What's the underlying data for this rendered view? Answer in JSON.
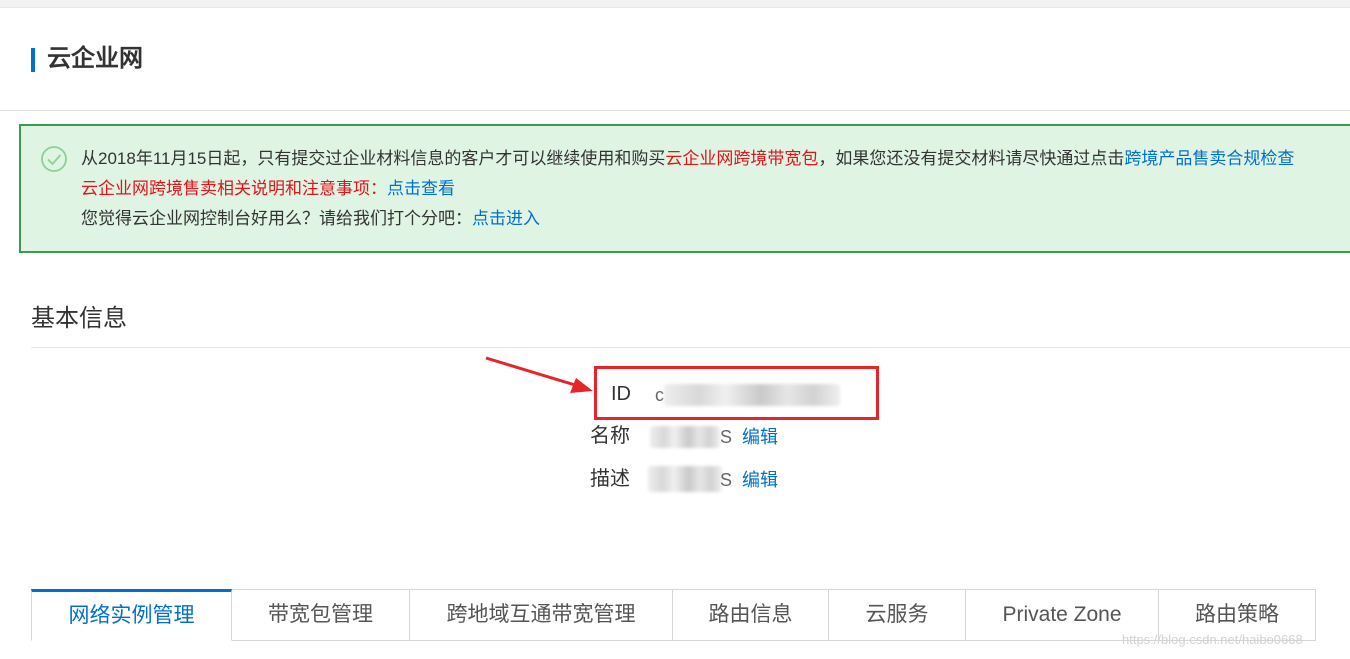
{
  "header": {
    "title": "云企业网"
  },
  "notice": {
    "line1": {
      "prefix": "从2018年11月15日起，只有提交过企业材料信息的客户才可以继续使用和购买",
      "highlight": "云企业网跨境带宽包",
      "middle": "，如果您还没有提交材料请尽快通过点击",
      "link": "跨境产品售卖合规检查"
    },
    "line2": {
      "highlight": "云企业网跨境售卖相关说明和注意事项",
      "colon": "：",
      "link": "点击查看"
    },
    "line3": {
      "text": "您觉得云企业网控制台好用么？请给我们打个分吧：",
      "link": "点击进入"
    }
  },
  "basic_info": {
    "title": "基本信息",
    "id_label": "ID",
    "id_value_prefix": "c",
    "name_label": "名称",
    "name_value_suffix": "S",
    "desc_label": "描述",
    "desc_value_suffix": "S",
    "edit_label": "编辑"
  },
  "tabs": [
    {
      "label": "网络实例管理",
      "active": true
    },
    {
      "label": "带宽包管理",
      "active": false
    },
    {
      "label": "跨地域互通带宽管理",
      "active": false
    },
    {
      "label": "路由信息",
      "active": false
    },
    {
      "label": "云服务",
      "active": false
    },
    {
      "label": "Private Zone",
      "active": false
    },
    {
      "label": "路由策略",
      "active": false
    }
  ],
  "watermark": "https://blog.csdn.net/haibo0668",
  "colors": {
    "accent": "#0070cc",
    "warning_red": "#e4131b",
    "notice_bg": "#e0f4e3",
    "notice_border": "#3c9a4e",
    "annotation_red": "#e5252a"
  },
  "icons": {
    "notice_icon": "check-circle-icon",
    "annotation": "red-arrow"
  }
}
